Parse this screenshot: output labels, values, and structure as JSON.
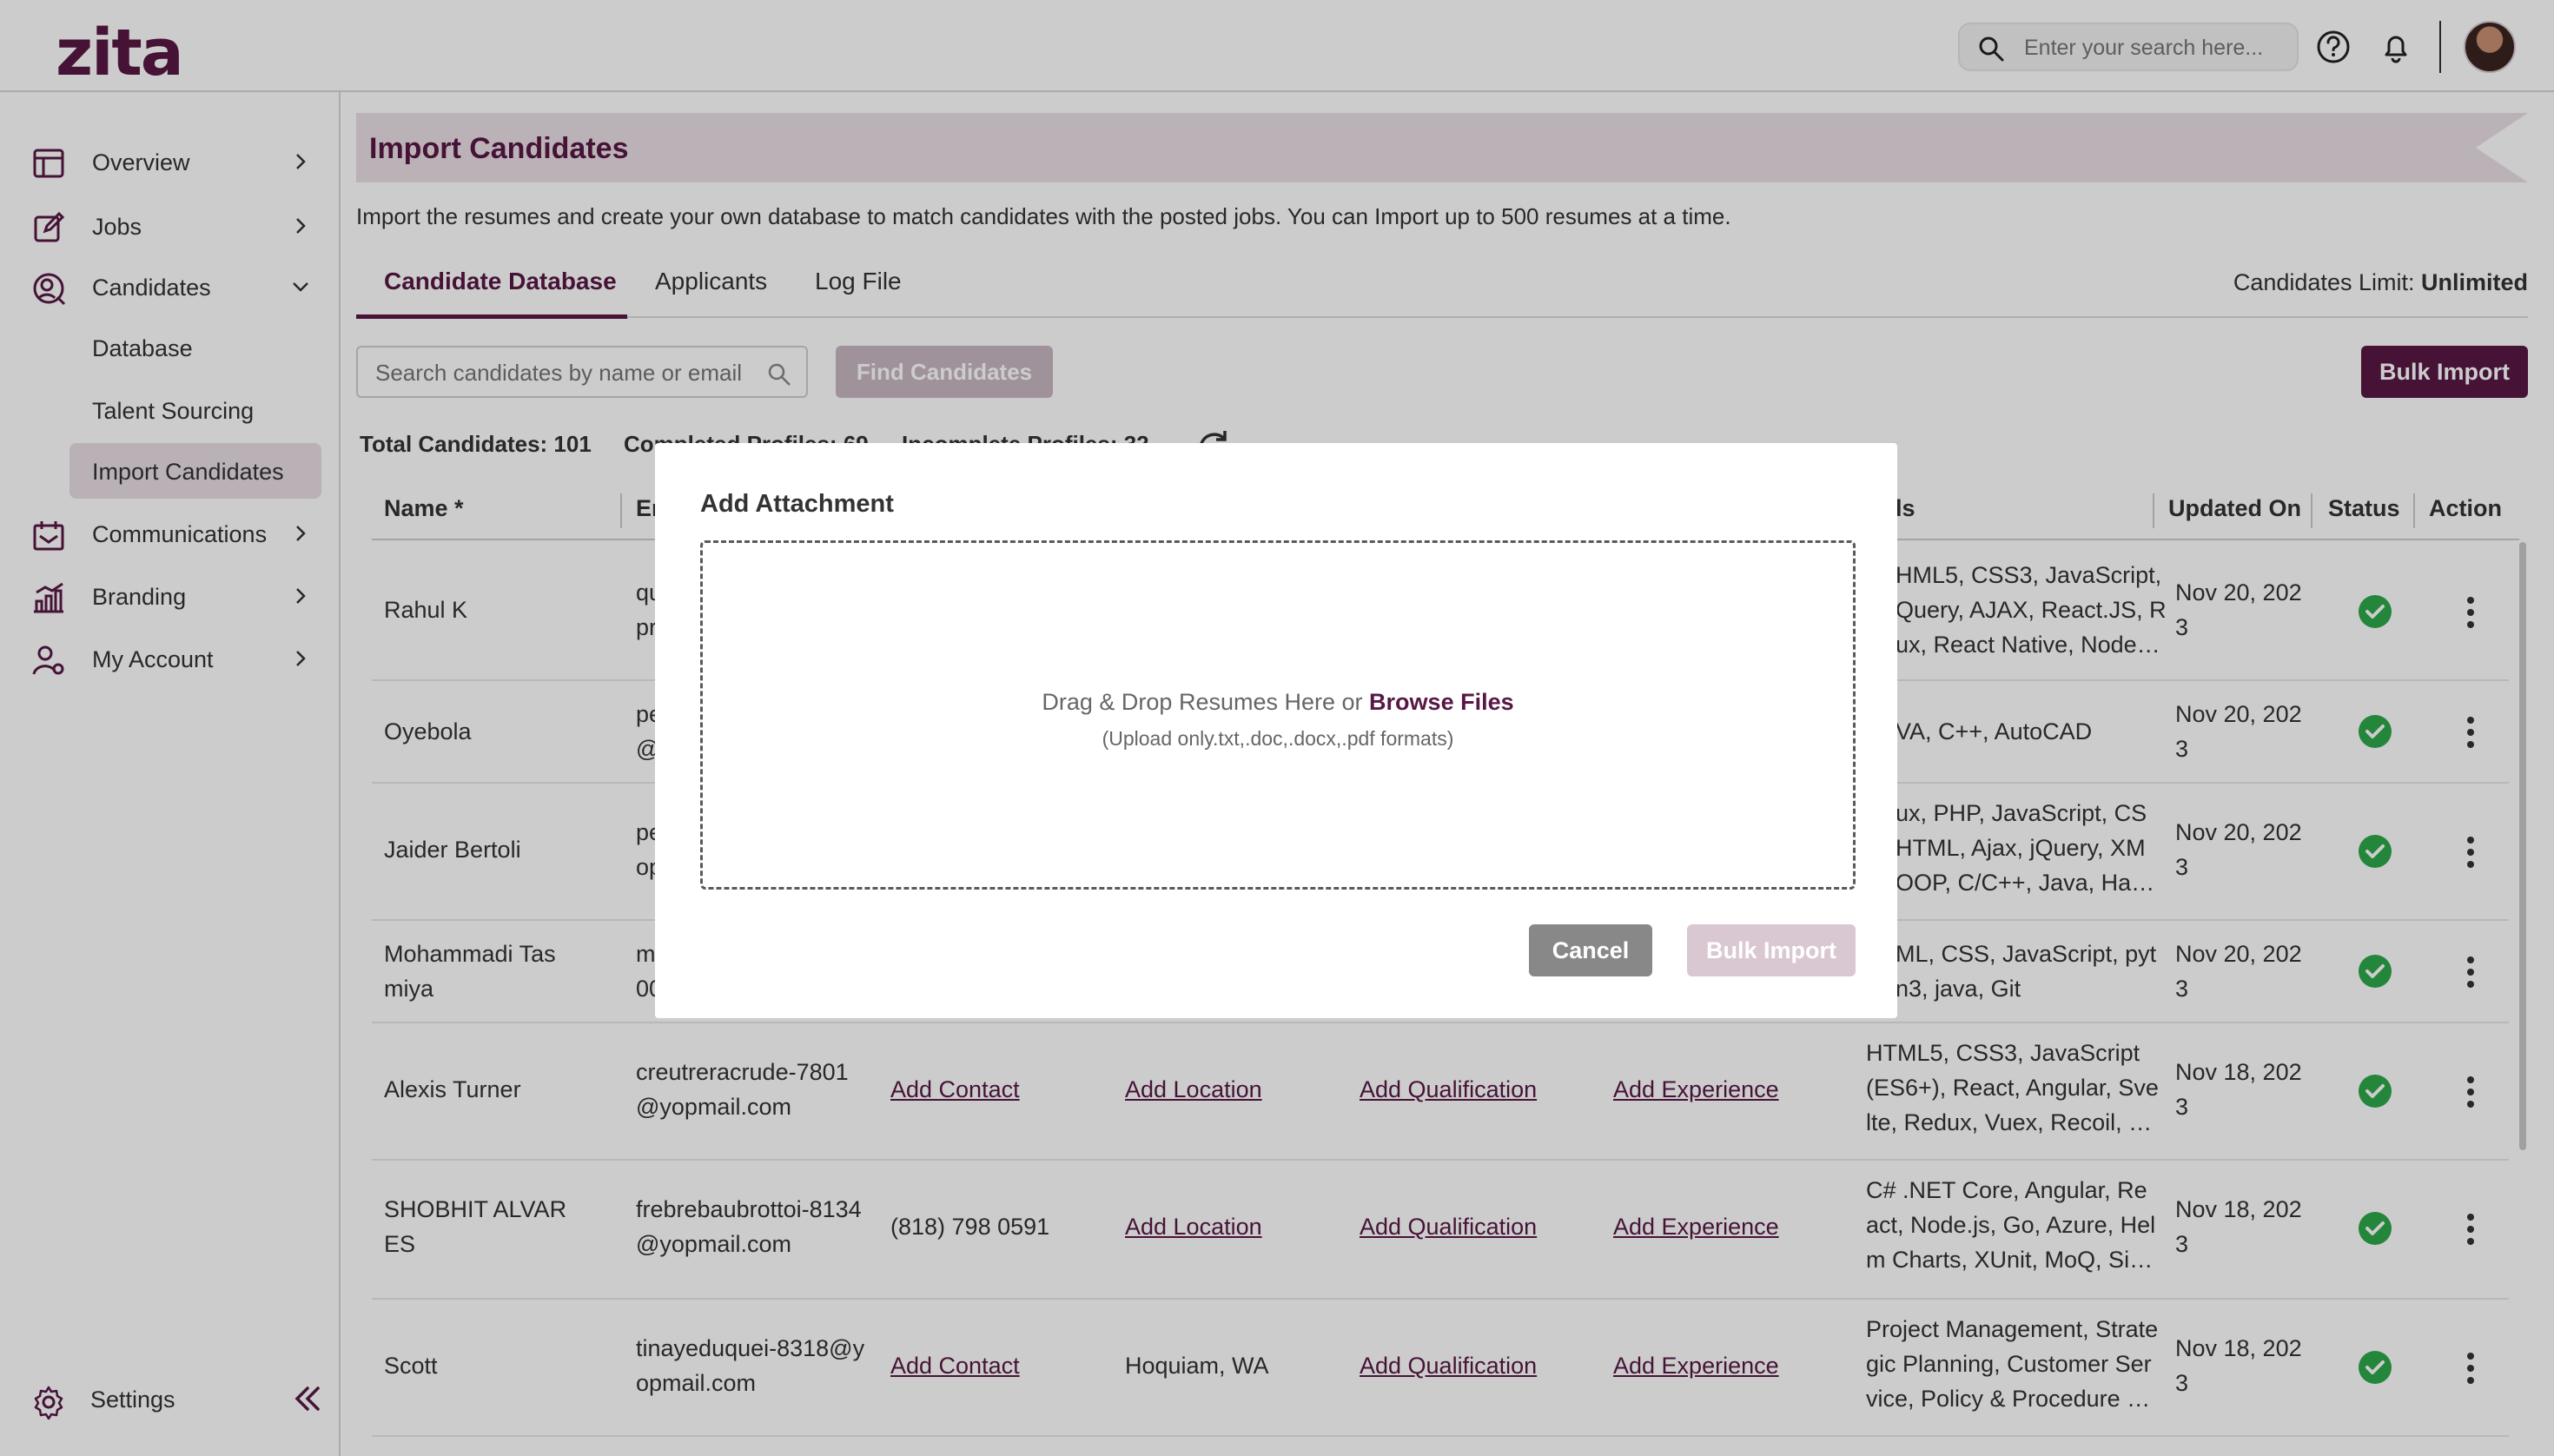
{
  "app": {
    "logo": "zita"
  },
  "header": {
    "search_placeholder": "Enter your search here...",
    "icons": [
      "search-icon",
      "help-icon",
      "bell-icon",
      "avatar"
    ]
  },
  "sidebar": {
    "items": [
      {
        "label": "Overview",
        "icon": "overview-icon"
      },
      {
        "label": "Jobs",
        "icon": "jobs-icon"
      },
      {
        "label": "Candidates",
        "icon": "candidates-icon"
      },
      {
        "label": "Communications",
        "icon": "communications-icon"
      },
      {
        "label": "Branding",
        "icon": "branding-icon"
      },
      {
        "label": "My Account",
        "icon": "account-icon"
      }
    ],
    "candidate_subitems": [
      "Database",
      "Talent Sourcing",
      "Import Candidates"
    ],
    "active_subitem": "Import Candidates",
    "settings_label": "Settings"
  },
  "page": {
    "title": "Import Candidates",
    "subtitle": "Import the resumes and create your own database to match candidates with the posted jobs. You can Import up to 500 resumes at a time.",
    "tabs": [
      "Candidate Database",
      "Applicants",
      "Log File"
    ],
    "active_tab": "Candidate Database",
    "limit_label": "Candidates Limit:",
    "limit_value": "Unlimited",
    "search_placeholder": "Search candidates by name or email",
    "find_button": "Find Candidates",
    "bulk_import_button": "Bulk Import",
    "stats": {
      "total": "Total Candidates: 101",
      "completed": "Completed Profiles: 69",
      "incomplete": "Incomplete Profiles: 32"
    }
  },
  "table": {
    "headers": [
      "Name *",
      "Em",
      "ls",
      "Updated On",
      "Status",
      "Action"
    ],
    "rows": [
      {
        "name": [
          "Rahul K"
        ],
        "email": [
          "qu",
          "pr"
        ],
        "contact": "",
        "location": "",
        "qualification": "",
        "experience": "",
        "skills": [
          "HML5, CSS3, JavaScript,",
          "Query, AJAX, React.JS, R",
          "ux, React Native, Node…"
        ],
        "updated": [
          "Nov 20, 202",
          "3"
        ]
      },
      {
        "name": [
          "Oyebola"
        ],
        "email": [
          "pe",
          "@"
        ],
        "contact": "",
        "location": "",
        "qualification": "",
        "experience": "",
        "skills": [
          "VA, C++, AutoCAD"
        ],
        "updated": [
          "Nov 20, 202",
          "3"
        ]
      },
      {
        "name": [
          "Jaider Bertoli"
        ],
        "email": [
          "pe",
          "op"
        ],
        "contact": "",
        "location": "",
        "qualification": "",
        "experience": "",
        "skills": [
          "ux, PHP, JavaScript, CS",
          "HTML, Ajax, jQuery, XM",
          "OOP, C/C++, Java, Ha…"
        ],
        "updated": [
          "Nov 20, 202",
          "3"
        ]
      },
      {
        "name": [
          "Mohammadi Tas",
          "miya"
        ],
        "email": [
          "m",
          "00"
        ],
        "contact": "",
        "location": "",
        "qualification": "",
        "experience": "",
        "skills": [
          "ML, CSS, JavaScript, pyt",
          "n3, java, Git"
        ],
        "updated": [
          "Nov 20, 202",
          "3"
        ]
      },
      {
        "name": [
          "Alexis Turner"
        ],
        "email": [
          "creutreracrude-7801",
          "@yopmail.com"
        ],
        "contact": "Add Contact",
        "location": "Add Location",
        "qualification": "Add Qualification",
        "experience": "Add Experience",
        "skills": [
          "HTML5, CSS3, JavaScript",
          "(ES6+), React, Angular, Sve",
          "lte, Redux, Vuex, Recoil, …"
        ],
        "updated": [
          "Nov 18, 202",
          "3"
        ]
      },
      {
        "name": [
          "SHOBHIT ALVAR",
          "ES"
        ],
        "email": [
          "frebrebaubrottoi-8134",
          "@yopmail.com"
        ],
        "contact": "(818) 798 0591",
        "location": "Add Location",
        "qualification": "Add Qualification",
        "experience": "Add Experience",
        "skills": [
          "C# .NET Core, Angular, Re",
          "act, Node.js, Go, Azure, Hel",
          "m Charts, XUnit, MoQ, Si…"
        ],
        "updated": [
          "Nov 18, 202",
          "3"
        ]
      },
      {
        "name": [
          "Scott"
        ],
        "email": [
          "tinayeduquei-8318@y",
          "opmail.com"
        ],
        "contact": "Add Contact",
        "location": "Hoquiam, WA",
        "qualification": "Add Qualification",
        "experience": "Add Experience",
        "skills": [
          "Project Management, Strate",
          "gic Planning, Customer Ser",
          "vice, Policy & Procedure …"
        ],
        "updated": [
          "Nov 18, 202",
          "3"
        ]
      }
    ]
  },
  "modal": {
    "title": "Add Attachment",
    "drop_text": "Drag & Drop Resumes Here or",
    "browse_label": "Browse Files",
    "formats_text": "(Upload only.txt,.doc,.docx,.pdf formats)",
    "cancel_button": "Cancel",
    "bulk_import_button": "Bulk Import"
  },
  "colors": {
    "brand": "#581845",
    "brand_light": "#eadfe5",
    "status_green": "#2ea84a"
  }
}
